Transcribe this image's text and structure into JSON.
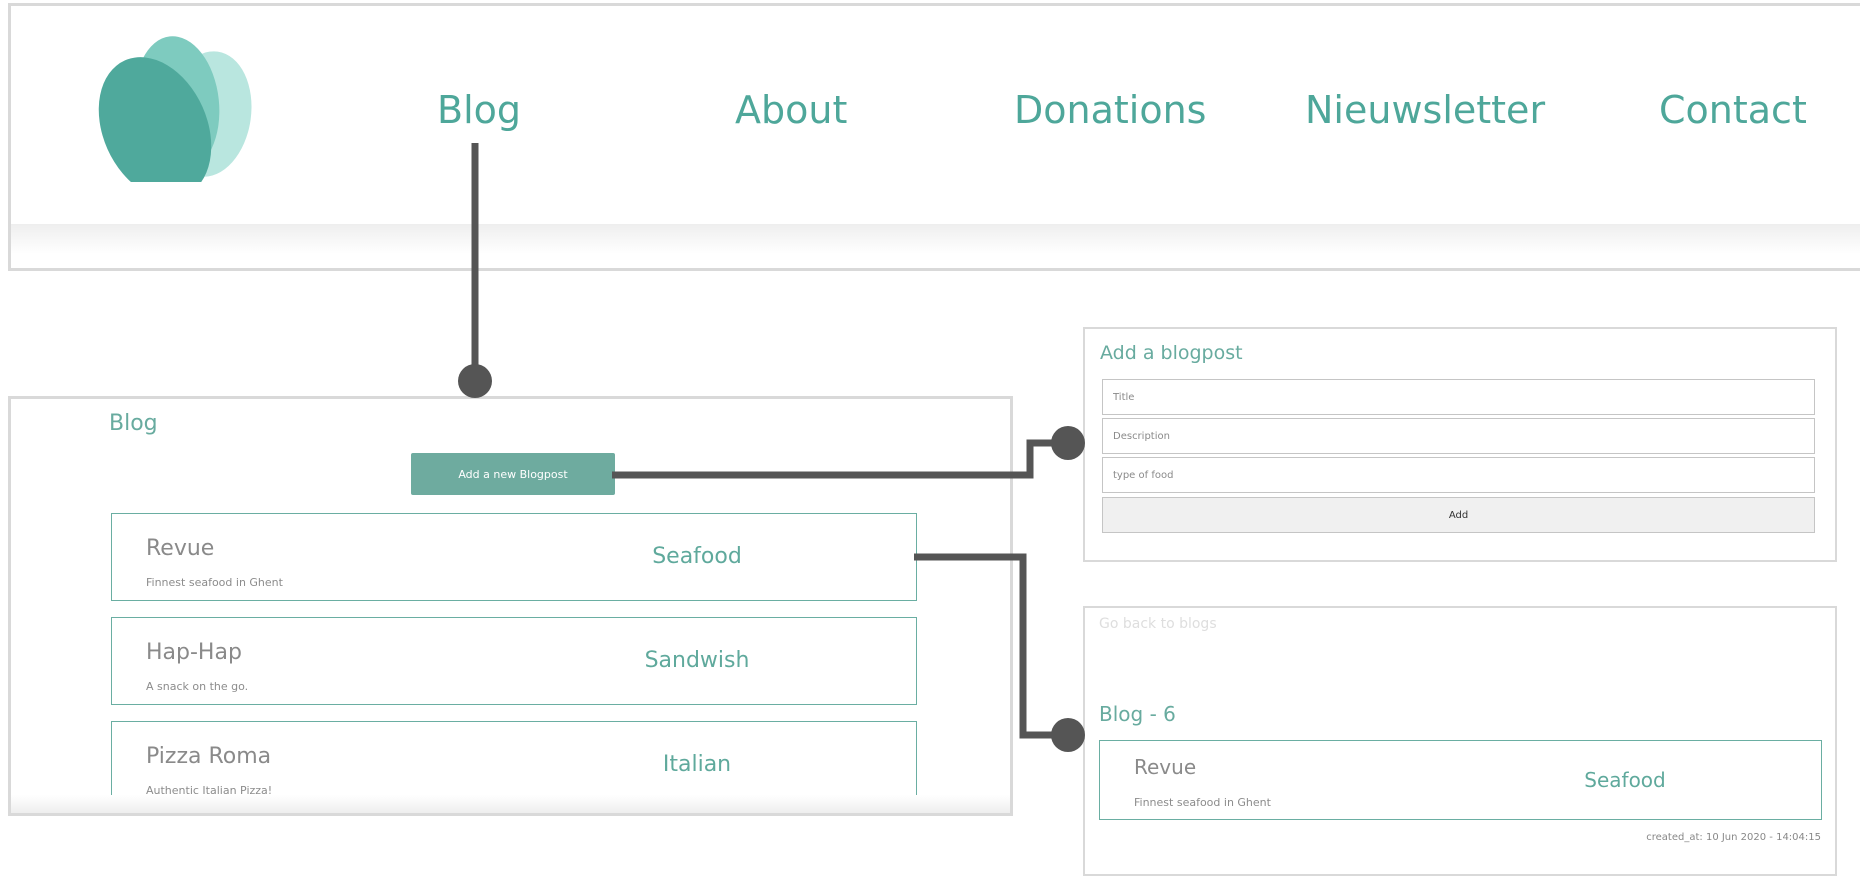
{
  "colors": {
    "accent": "#4ea79a",
    "button": "#6eab9f",
    "card_border": "#6aaea2",
    "connector": "#555555",
    "frame_border": "#d9d9d9"
  },
  "logo": {
    "icon": "leaf-logo-icon"
  },
  "nav": {
    "items": [
      {
        "label": "Blog"
      },
      {
        "label": "About"
      },
      {
        "label": "Donations"
      },
      {
        "label": "Nieuwsletter"
      },
      {
        "label": "Contact"
      }
    ]
  },
  "blog_page": {
    "title": "Blog",
    "add_button_label": "Add a new Blogpost",
    "posts": [
      {
        "title": "Revue",
        "description": "Finnest seafood in Ghent",
        "type": "Seafood"
      },
      {
        "title": "Hap-Hap",
        "description": "A snack on the go.",
        "type": "Sandwish"
      },
      {
        "title": "Pizza Roma",
        "description": "Authentic Italian Pizza!",
        "type": "Italian"
      }
    ]
  },
  "add_form": {
    "title": "Add a blogpost",
    "title_placeholder": "Title",
    "description_placeholder": "Description",
    "food_type_placeholder": "type of food",
    "submit_label": "Add"
  },
  "detail_page": {
    "back_link": "Go back to blogs",
    "heading": "Blog - 6",
    "post": {
      "title": "Revue",
      "description": "Finnest seafood in Ghent",
      "type": "Seafood"
    },
    "created_at": "created_at: 10 Jun 2020 - 14:04:15"
  }
}
